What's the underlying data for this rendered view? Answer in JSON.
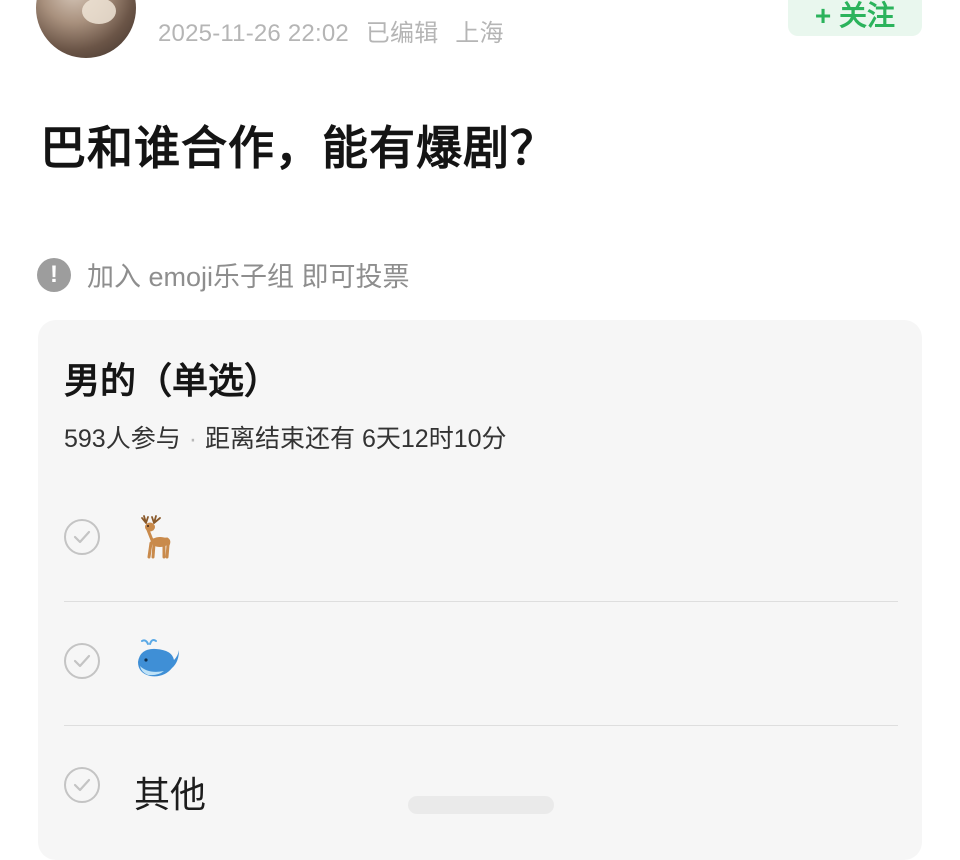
{
  "post": {
    "timestamp": "2025-11-26 22:02",
    "edited_label": "已编辑",
    "location": "上海",
    "follow_label": "+ 关注",
    "title": "巴和谁合作，能有爆剧？"
  },
  "notice": {
    "icon": "exclamation-icon",
    "text": "加入 emoji乐子组 即可投票"
  },
  "poll": {
    "title": "男的（单选）",
    "participants": "593人参与",
    "separator": "·",
    "time_remaining": "距离结束还有 6天12时10分",
    "options": [
      {
        "icon": "deer-emoji",
        "label": ""
      },
      {
        "icon": "whale-emoji",
        "label": ""
      },
      {
        "icon": "",
        "label": "其他"
      }
    ]
  },
  "colors": {
    "accent_green": "#2bb35c",
    "follow_bg": "#e9f7ee",
    "card_bg": "#f6f6f6",
    "muted_text": "#b5b5b5"
  }
}
